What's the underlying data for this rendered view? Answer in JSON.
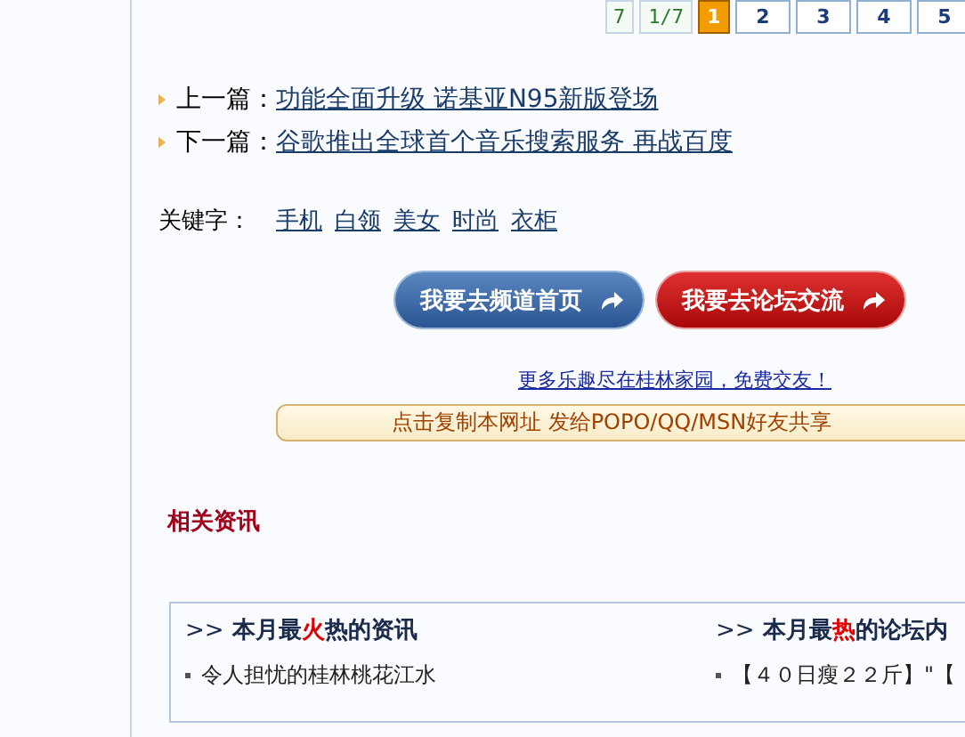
{
  "pagination": {
    "total": "7",
    "ratio": "1/7",
    "pages": [
      {
        "label": "1",
        "selected": true
      },
      {
        "label": "2",
        "selected": false
      },
      {
        "label": "3",
        "selected": false
      },
      {
        "label": "4",
        "selected": false
      },
      {
        "label": "5",
        "selected": false
      }
    ]
  },
  "neighbors": [
    {
      "label": "上一篇：",
      "title": "功能全面升级 诺基亚N95新版登场"
    },
    {
      "label": "下一篇：",
      "title": "谷歌推出全球首个音乐搜索服务 再战百度"
    }
  ],
  "keywords": {
    "label": "关键字：",
    "items": [
      "手机",
      "白领",
      "美女",
      "时尚",
      "衣柜"
    ]
  },
  "buttons": [
    {
      "label": "我要去频道首页",
      "kind": "blue"
    },
    {
      "label": "我要去论坛交流",
      "kind": "red"
    }
  ],
  "promo_link": "更多乐趣尽在桂林家园，免费交友！",
  "share_bar": "点击复制本网址 发给POPO/QQ/MSN好友共享",
  "related_title": "相关资讯",
  "panels": [
    {
      "arrow": ">>",
      "before": "本月最",
      "hot": "火",
      "after": "热的资讯",
      "items": [
        "令人担忧的桂林桃花江水"
      ]
    },
    {
      "arrow": ">>",
      "before": "本月最",
      "hot": "热",
      "after": "的论坛内",
      "items": [
        "【４０日瘦２２斤】\"【"
      ]
    }
  ]
}
